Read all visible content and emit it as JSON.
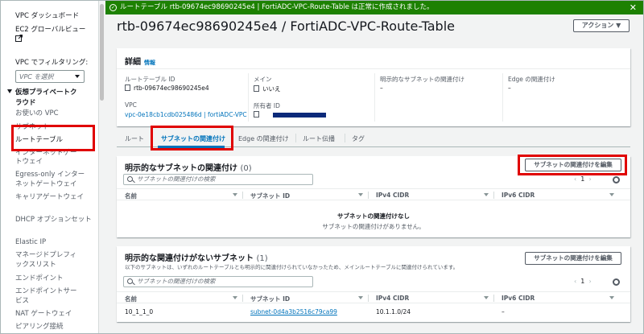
{
  "sidebar": {
    "items_top": [
      "VPC ダッシュボード",
      "EC2 グローバルビュー"
    ],
    "filter_label": "VPC でフィルタリング:",
    "filter_placeholder": "VPC を選択",
    "section_title_1": "仮想プライベートク",
    "section_title_2": "ラウド",
    "items": [
      "お使いの VPC",
      "サブネット",
      "ルートテーブル",
      "インターネットゲー",
      "トウェイ",
      "Egress-only インター",
      "ネットゲートウェイ",
      "キャリアゲートウェイ",
      "DHCP オプションセット",
      "Elastic IP",
      "マネージドプレフィ",
      "ックスリスト",
      "エンドポイント",
      "エンドポイントサー",
      "ビス",
      "NAT ゲートウェイ",
      "ピアリング接続"
    ]
  },
  "flash": {
    "message": "ルートテーブル rtb-09674ec98690245e4 | FortiADC-VPC-Route-Table は正常に作成されました。",
    "close": "✕",
    "color": "#1d8102"
  },
  "header": {
    "title": "rtb-09674ec98690245e4 / FortiADC-VPC-Route-Table",
    "actions_label": "アクション ▼"
  },
  "details": {
    "title": "詳細",
    "info": "情報",
    "fields": {
      "route_table_id_label": "ルートテーブル ID",
      "route_table_id": "rtb-09674ec98690245e4",
      "main_label": "メイン",
      "main": "いいえ",
      "explicit_label": "明示的なサブネットの関連付け",
      "explicit": "–",
      "edge_label": "Edge の関連付け",
      "edge": "–",
      "vpc_label": "VPC",
      "vpc": "vpc-0e18cb1cdb025486d | fortiADC-VPC",
      "owner_label": "所有者 ID"
    }
  },
  "tabs": [
    "ルート",
    "サブネットの関連付け",
    "Edge の関連付け",
    "ルート伝播",
    "タグ"
  ],
  "explicit_assoc": {
    "title": "明示的なサブネットの関連付け",
    "count": "(0)",
    "edit_button": "サブネットの関連付けを編集",
    "search_placeholder": "サブネットの関連付けの検索",
    "page": "1",
    "columns": [
      "名前",
      "サブネット ID",
      "IPv4 CIDR",
      "IPv6 CIDR"
    ],
    "empty_title": "サブネットの関連付けなし",
    "empty_text": "サブネットの関連付けがありません。"
  },
  "non_explicit": {
    "title": "明示的な関連付けがないサブネット",
    "count": "(1)",
    "edit_button": "サブネットの関連付けを編集",
    "description": "以下のサブネットは、いずれのルートテーブルとも明示的に関連付けられていなかったため、メインルートテーブルに関連付けられています。",
    "search_placeholder": "サブネットの関連付けの検索",
    "page": "1",
    "columns": [
      "名前",
      "サブネット ID",
      "IPv4 CIDR",
      "IPv6 CIDR"
    ],
    "rows": [
      {
        "name": "10_1_1_0",
        "subnet_id": "subnet-0d4a3b2516c79ca99",
        "ipv4": "10.1.1.0/24",
        "ipv6": "–"
      }
    ]
  }
}
